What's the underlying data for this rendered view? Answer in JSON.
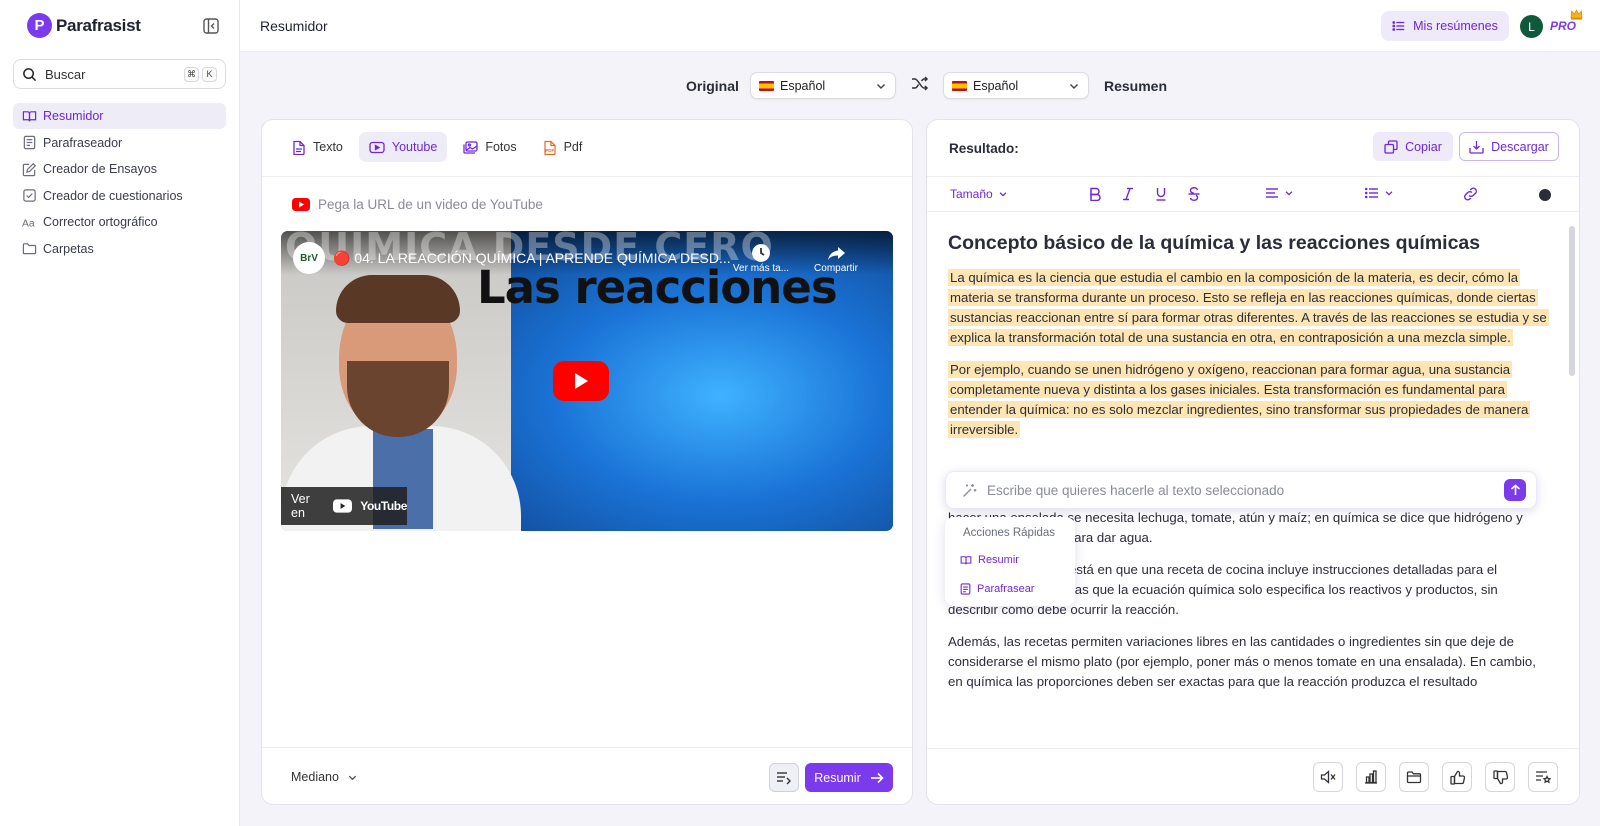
{
  "app": {
    "name": "Parafrasist"
  },
  "sidebar": {
    "search": {
      "label": "Buscar",
      "kbd1": "⌘",
      "kbd2": "K"
    },
    "items": [
      {
        "label": "Resumidor",
        "icon": "book-open-icon",
        "active": true
      },
      {
        "label": "Parafraseador",
        "icon": "document-lines-icon"
      },
      {
        "label": "Creador de Ensayos",
        "icon": "edit-icon"
      },
      {
        "label": "Creador de cuestionarios",
        "icon": "checkbox-icon"
      },
      {
        "label": "Corrector ortográfico",
        "icon": "spellcheck-icon"
      },
      {
        "label": "Carpetas",
        "icon": "folder-icon"
      }
    ]
  },
  "header": {
    "title": "Resumidor",
    "my_summaries": "Mis resúmenes",
    "avatar_initial": "L",
    "plan": "PRO"
  },
  "languages": {
    "original_label": "Original",
    "summary_label": "Resumen",
    "source": "Español",
    "target": "Español"
  },
  "input_panel": {
    "tabs": [
      {
        "label": "Texto",
        "icon": "file-text-icon"
      },
      {
        "label": "Youtube",
        "icon": "youtube-icon",
        "active": true
      },
      {
        "label": "Fotos",
        "icon": "image-icon"
      },
      {
        "label": "Pdf",
        "icon": "pdf-icon"
      }
    ],
    "url_placeholder": "Pega la URL de un video de YouTube",
    "video": {
      "overlay_big": "QUIMICA DESDE CERO",
      "channel_badge": "BrV",
      "title": "🔴 04. LA REACCIÓN QUÍMICA | APRENDE QUÍMICA DESD...",
      "watch_later": "Ver más ta...",
      "share": "Compartir",
      "thumbnail_text": "Las reacciones",
      "watch_on": "Ver en",
      "youtube_word": "YouTube"
    },
    "size": "Mediano",
    "submit": "Resumir"
  },
  "result_panel": {
    "label": "Resultado:",
    "copy": "Copiar",
    "download": "Descargar",
    "size_menu": "Tamaño",
    "heading": "Concepto básico de la química y las reacciones químicas",
    "p1": "La química es la ciencia que estudia el cambio en la composición de la materia, es decir, cómo la materia se transforma durante un proceso. Esto se refleja en las reacciones químicas, donde ciertas sustancias reaccionan entre sí para formar otras diferentes. A través de las reacciones se estudia y se explica la transformación total de una sustancia en otra, en contraposición a una mezcla simple.",
    "p2": "Por ejemplo, cuando se unen hidrógeno y oxígeno, reaccionan para formar agua, una sustancia completamente nueva y distinta a los gases iniciales. Esta transformación es fundamental para entender la química: no es solo mezclar ingredientes, sino transformar sus propiedades de manera irreversible.",
    "p3": "Es posible comparar la ecuación química con una receta de cocina. En ambas se identifican los \"ingredientes\" (reactivos en química) y el producto final. Por ejemplo, en cocina se indica que para hacer una ensalada se necesita lechuga, tomate, atún y maíz; en química se dice que hidrógeno y oxígeno reaccionan para dar agua.",
    "p4": "La diferencia crucial está en que una receta de cocina incluye instrucciones detalladas para el procedimiento, mientras que la ecuación química solo especifica los reactivos y productos, sin describir cómo debe ocurrir la reacción.",
    "p5": "Además, las recetas permiten variaciones libres en las cantidades o ingredientes sin que deje de considerarse el mismo plato (por ejemplo, poner más o menos tomate en una ensalada). En cambio, en química las proporciones deben ser exactas para que la reacción produzca el resultado",
    "ai_placeholder": "Escribe que quieres hacerle al texto seleccionado",
    "quick_actions": {
      "title": "Acciones Rápidas",
      "items": [
        "Resumir",
        "Parafrasear"
      ]
    }
  },
  "colors": {
    "accent": "#7c3aed",
    "highlight": "#fde6b4",
    "youtube": "#ff0000"
  }
}
